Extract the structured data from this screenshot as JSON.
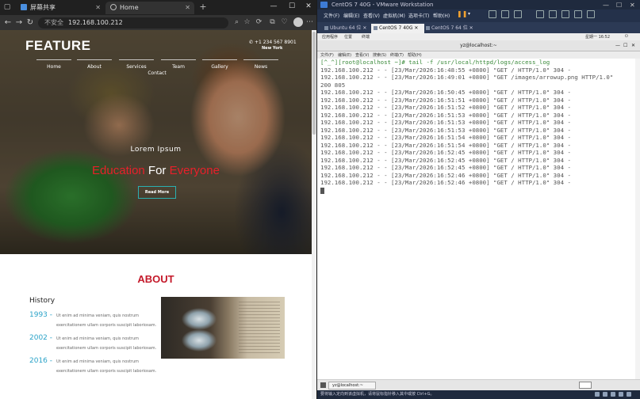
{
  "browser": {
    "tabs": [
      {
        "label": "屏幕共享",
        "icon": "share-screen-icon"
      },
      {
        "label": "Home",
        "icon": "globe-icon"
      }
    ],
    "new_tab": "+",
    "address": {
      "security": "不安全",
      "url": "192.168.100.212"
    },
    "window_controls": {
      "minimize": "—",
      "maximize": "☐",
      "close": "✕"
    }
  },
  "site": {
    "logo": "FEATURE",
    "phone": "+1 234 567 8901",
    "city": "New York",
    "menu": [
      "Home",
      "About",
      "Services",
      "Team",
      "Gallery",
      "News"
    ],
    "menu_sub": "Contact",
    "hero": {
      "subtitle": "Lorem Ipsum",
      "title_red_1": "Education",
      "title_white": " For ",
      "title_red_2": "Everyone",
      "button": "Read More"
    },
    "about": {
      "title": "ABOUT",
      "history_heading": "History",
      "timeline": [
        {
          "year": "1993 -",
          "line1": "Ut enim ad minima veniam, quis nostrum",
          "line2": "exercitationem ullam corporis suscipit laboriosam."
        },
        {
          "year": "2002 -",
          "line1": "Ut enim ad minima veniam, quis nostrum",
          "line2": "exercitationem ullam corporis suscipit laboriosam."
        },
        {
          "year": "2016 -",
          "line1": "Ut enim ad minima veniam, quis nostrum",
          "line2": "exercitationem ullam corporis suscipit laboriosam."
        }
      ]
    }
  },
  "vmware": {
    "title": "CentOS 7 40G - VMware Workstation",
    "menu": [
      "文件(F)",
      "编辑(E)",
      "查看(V)",
      "虚拟机(M)",
      "选项卡(T)",
      "帮助(H)"
    ],
    "tabs": [
      {
        "label": "Ubuntu 64 位"
      },
      {
        "label": "CentOS 7 40G",
        "active": true
      },
      {
        "label": "CentOS 7 64 位"
      }
    ],
    "gnome_bar": {
      "apps": "应用程序",
      "places": "位置",
      "terminal": "终端",
      "clock": "星期一 16:52"
    },
    "terminal_title": "yz@localhost:~",
    "terminal_menu": [
      "文件(F)",
      "编辑(E)",
      "查看(V)",
      "搜索(S)",
      "终端(T)",
      "帮助(H)"
    ],
    "prompt": "[^_^][root@localhost ~]# tail -f /usr/local/httpd/logs/access_log",
    "log_lines": [
      "192.168.100.212 - - [23/Mar/2026:16:48:55 +0800] \"GET / HTTP/1.0\" 304 -",
      "192.168.100.212 - - [23/Mar/2026:16:49:01 +0800] \"GET /images/arrowup.png HTTP/1.0\"",
      "200 805",
      "192.168.100.212 - - [23/Mar/2026:16:50:45 +0800] \"GET / HTTP/1.0\" 304 -",
      "192.168.100.212 - - [23/Mar/2026:16:51:51 +0800] \"GET / HTTP/1.0\" 304 -",
      "192.168.100.212 - - [23/Mar/2026:16:51:52 +0800] \"GET / HTTP/1.0\" 304 -",
      "192.168.100.212 - - [23/Mar/2026:16:51:53 +0800] \"GET / HTTP/1.0\" 304 -",
      "192.168.100.212 - - [23/Mar/2026:16:51:53 +0800] \"GET / HTTP/1.0\" 304 -",
      "192.168.100.212 - - [23/Mar/2026:16:51:53 +0800] \"GET / HTTP/1.0\" 304 -",
      "192.168.100.212 - - [23/Mar/2026:16:51:54 +0800] \"GET / HTTP/1.0\" 304 -",
      "192.168.100.212 - - [23/Mar/2026:16:51:54 +0800] \"GET / HTTP/1.0\" 304 -",
      "192.168.100.212 - - [23/Mar/2026:16:52:45 +0800] \"GET / HTTP/1.0\" 304 -",
      "192.168.100.212 - - [23/Mar/2026:16:52:45 +0800] \"GET / HTTP/1.0\" 304 -",
      "192.168.100.212 - - [23/Mar/2026:16:52:45 +0800] \"GET / HTTP/1.0\" 304 -",
      "192.168.100.212 - - [23/Mar/2026:16:52:46 +0800] \"GET / HTTP/1.0\" 304 -",
      "192.168.100.212 - - [23/Mar/2026:16:52:46 +0800] \"GET / HTTP/1.0\" 304 -"
    ],
    "taskbar_item": "yz@localhost:~",
    "status": "要将输入定向到该虚拟机，请将鼠标指针移入其中或按 Ctrl+G。"
  }
}
